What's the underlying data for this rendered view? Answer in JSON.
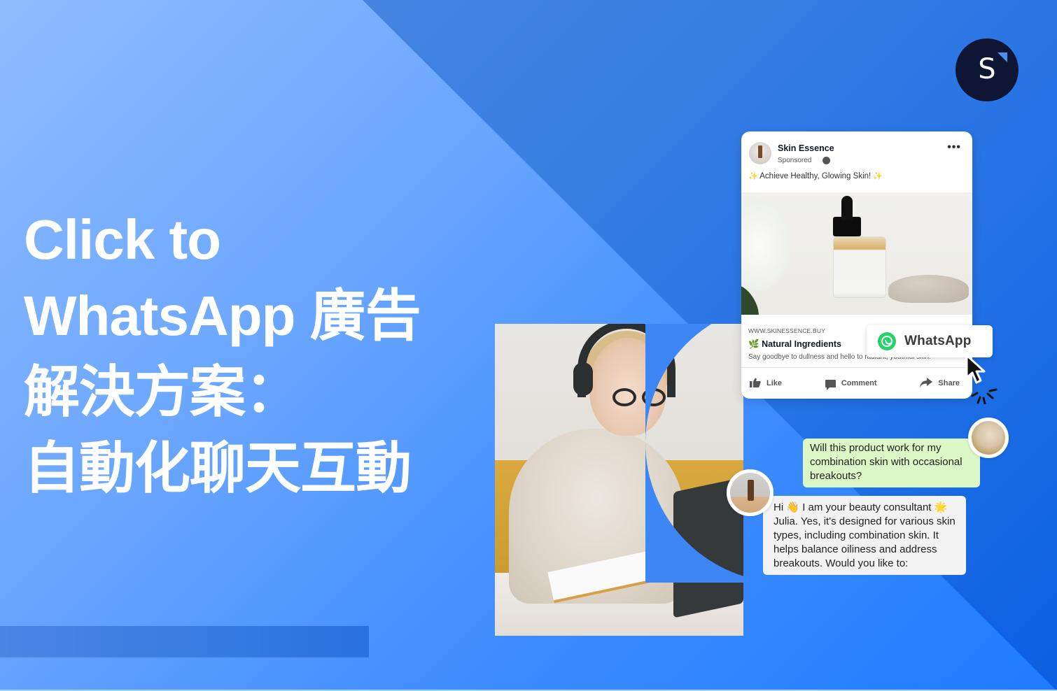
{
  "brand": {
    "logo_letter": "S",
    "colors": {
      "background_light": "#8fbcff",
      "background_mid": "#3f8dff",
      "background_dark": "#0b5fe0",
      "logo_bg": "#0e1633",
      "logo_accent": "#4a90ef",
      "whatsapp_green": "#25d366",
      "user_bubble": "#dcf8c6",
      "bot_bubble": "#f3f3f3"
    }
  },
  "headline": {
    "lines": [
      "Click to",
      "WhatsApp 廣告",
      "解決方案：",
      "自動化聊天互動"
    ]
  },
  "ad": {
    "page_name": "Skin Essence",
    "sponsored": "Sponsored",
    "more_icon": "•••",
    "tagline": "Achieve Healthy, Glowing Skin!",
    "sparkle": "✨",
    "url": "WWW.SKINESSENCE.BUY",
    "headline_emoji": "🌿",
    "headline": "Natural Ingredients",
    "description": "Say goodbye to dullness and hello to radiant, youthful skin.",
    "actions": [
      {
        "label": "Like",
        "icon": "thumbs-up-icon"
      },
      {
        "label": "Comment",
        "icon": "comment-icon"
      },
      {
        "label": "Share",
        "icon": "share-icon"
      }
    ]
  },
  "cta": {
    "label": "WhatsApp",
    "icon": "whatsapp-icon"
  },
  "chat": {
    "user_message": "Will this product work for my combination skin with occasional breakouts?",
    "bot_message_parts": {
      "greeting": "Hi",
      "wave_emoji": "👋",
      "intro": " I am your beauty consultant",
      "star_emoji": "🌟",
      "body": "Julia. Yes, it's designed for various skin types, including combination skin. It helps balance oiliness and address breakouts. Would you like to:"
    }
  }
}
